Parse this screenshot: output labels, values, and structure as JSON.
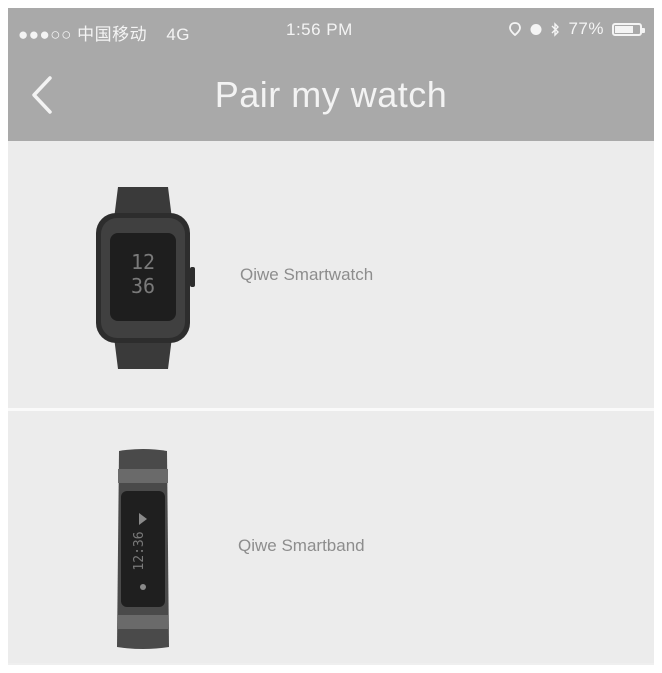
{
  "status_bar": {
    "carrier": "●●●○○ 中国移动",
    "network": "4G",
    "time": "1:56 PM",
    "battery_percent": "77%",
    "battery_level": 0.77
  },
  "header": {
    "back_icon": "chevron-left-icon",
    "title": "Pair my watch"
  },
  "devices": [
    {
      "label": "Qiwe Smartwatch",
      "image": "smartwatch-image"
    },
    {
      "label": "Qiwe Smartband",
      "image": "smartband-image"
    }
  ],
  "colors": {
    "header": "#a9a9a9",
    "list_background": "#ececec",
    "divider": "#fafafa",
    "label_text": "#8d8d8d",
    "device_body": "#3a3a3a"
  }
}
